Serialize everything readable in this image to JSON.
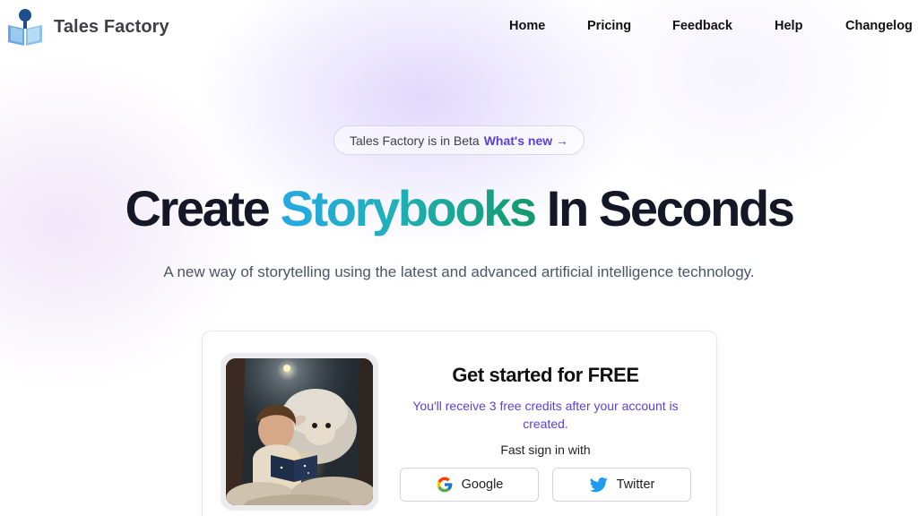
{
  "header": {
    "brand": "Tales Factory",
    "nav": [
      {
        "label": "Home"
      },
      {
        "label": "Pricing"
      },
      {
        "label": "Feedback"
      },
      {
        "label": "Help"
      },
      {
        "label": "Changelog"
      }
    ]
  },
  "hero": {
    "badge_text": "Tales Factory is in Beta",
    "badge_link": "What's new →",
    "headline_pre": "Create",
    "headline_accent": "Storybooks",
    "headline_post": "In Seconds",
    "subtitle": "A new way of storytelling using the latest and advanced artificial intelligence technology."
  },
  "signup": {
    "title": "Get started for FREE",
    "note": "You'll receive 3 free credits after your account is created.",
    "fast_label": "Fast sign in with",
    "google_label": "Google",
    "twitter_label": "Twitter",
    "image_icon": "child-reading-with-lamb-illustration"
  },
  "colors": {
    "accent": "#5b3fd6",
    "headline": "#141726",
    "gradient_start": "#26a9e4",
    "gradient_end": "#129a6a",
    "twitter": "#1d9bf0"
  }
}
